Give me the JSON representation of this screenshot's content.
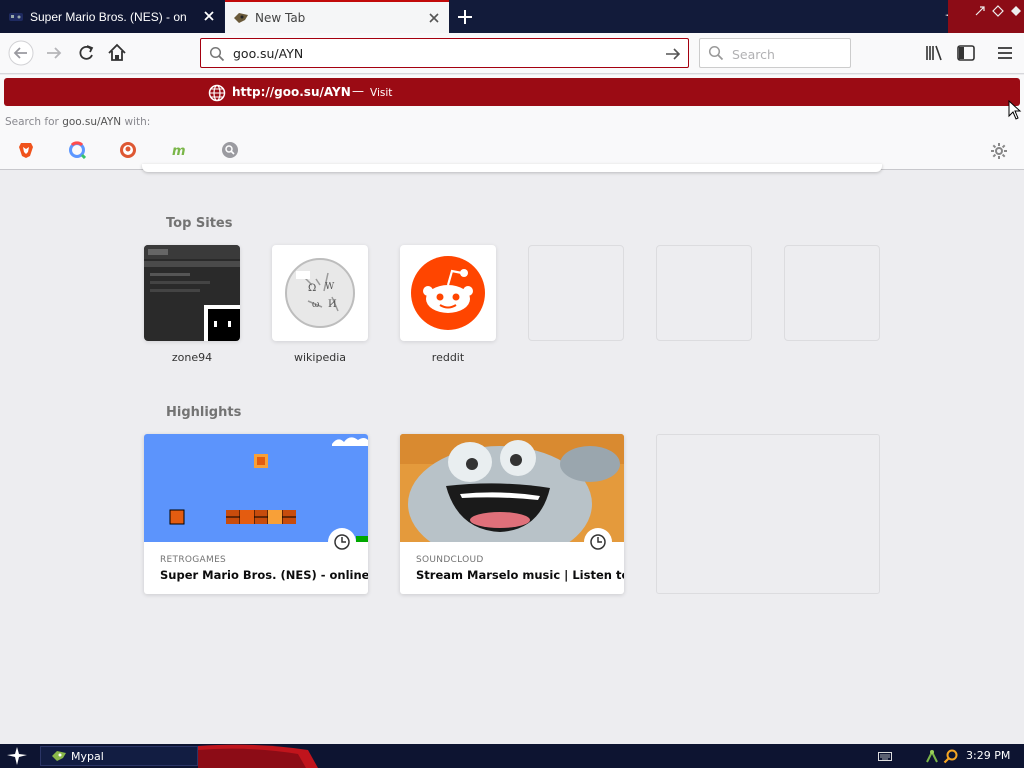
{
  "tabs": [
    {
      "title": "Super Mario Bros. (NES) - online game",
      "active": false,
      "icon": "mario-favicon"
    },
    {
      "title": "New Tab",
      "active": true,
      "icon": "mypal-favicon"
    }
  ],
  "navbar": {
    "url": "goo.su/AYN",
    "search_placeholder": "Search"
  },
  "urlbar_popup": {
    "highlighted_url": "http://goo.su/AYN",
    "separator": "—",
    "action": "Visit",
    "search_with_prefix": "Search for ",
    "search_with_query": "goo.su/AYN",
    "search_with_suffix": " with:",
    "engines": [
      "brave-icon",
      "qwant-icon",
      "duckduckgo-icon",
      "mojeek-icon",
      "search-engine-icon"
    ]
  },
  "content": {
    "top_sites_title": "Top Sites",
    "top_sites": [
      {
        "label": "zone94"
      },
      {
        "label": "wikipedia"
      },
      {
        "label": "reddit"
      },
      {
        "label": ""
      },
      {
        "label": ""
      },
      {
        "label": ""
      }
    ],
    "highlights_title": "Highlights",
    "highlights": [
      {
        "source": "RETROGAMES",
        "title": "Super Mario Bros. (NES) - online ..."
      },
      {
        "source": "SOUNDCLOUD",
        "title": "Stream Marselo music | Listen to..."
      }
    ]
  },
  "taskbar": {
    "app_label": "Mypal",
    "clock": "3:29 PM"
  },
  "colors": {
    "accent": "#a4000f",
    "tabbar": "#121b3a",
    "taskbar": "#0d1431"
  }
}
